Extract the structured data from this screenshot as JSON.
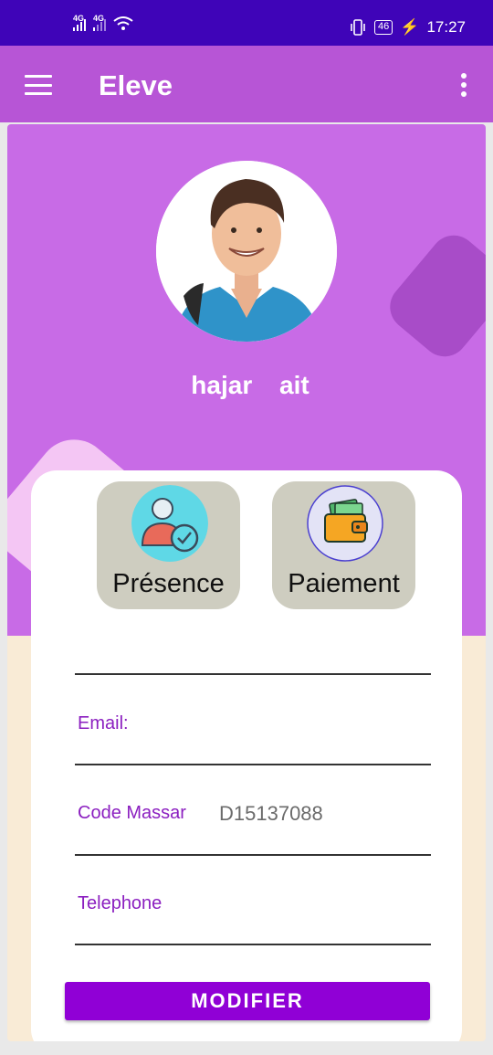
{
  "status_bar": {
    "network_1": "4G",
    "network_2": "4G",
    "battery": "46",
    "time": "17:27"
  },
  "app_bar": {
    "title": "Eleve",
    "menu_icon": "hamburger-icon",
    "more_icon": "more-vert-icon"
  },
  "profile": {
    "name": "hajar ait"
  },
  "tiles": [
    {
      "label": "Présence",
      "icon": "attendance-check-icon"
    },
    {
      "label": "Paiement",
      "icon": "wallet-icon"
    }
  ],
  "fields": {
    "email_label": "Email:",
    "code_massar_label": "Code Massar",
    "code_massar_value": "D15137088",
    "telephone_label": "Telephone"
  },
  "actions": {
    "modify_label": "MODIFIER"
  },
  "colors": {
    "status_bar": "#3f04b8",
    "app_bar": "#b755d6",
    "header_bg": "#c86be6",
    "accent": "#9000d6",
    "label": "#8b1fc0"
  }
}
